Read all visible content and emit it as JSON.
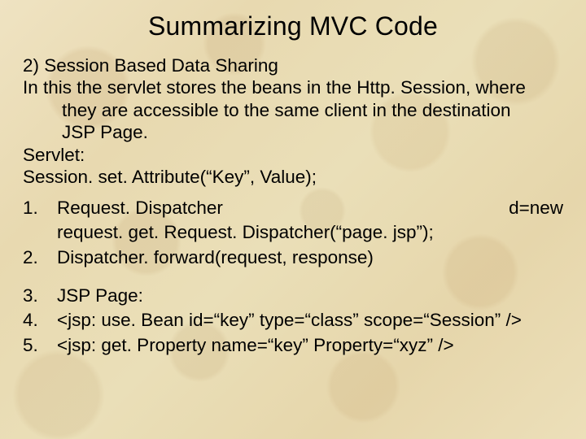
{
  "title": "Summarizing MVC Code",
  "intro": {
    "heading": "2) Session Based Data Sharing",
    "line1_a": "In this the servlet stores the beans in the Http. Session, where",
    "line1_b": "they are accessible to the same client in the destination",
    "line1_c": "JSP Page.",
    "servlet_label": "Servlet:",
    "servlet_code": "Session. set. Attribute(“Key”, Value);"
  },
  "items": [
    {
      "num": "1.",
      "content_a": "Request. Dispatcher",
      "right": "d=new",
      "content_b": "request. get. Request. Dispatcher(“page. jsp”);"
    },
    {
      "num": "2.",
      "content_a": "Dispatcher. forward(request, response)"
    },
    {
      "num": "3.",
      "content_a": "JSP Page:"
    },
    {
      "num": "4.",
      "content_a": "<jsp: use. Bean id=“key” type=“class” scope=“Session” />"
    },
    {
      "num": "5.",
      "content_a": "<jsp: get. Property name=“key” Property=“xyz” />"
    }
  ]
}
